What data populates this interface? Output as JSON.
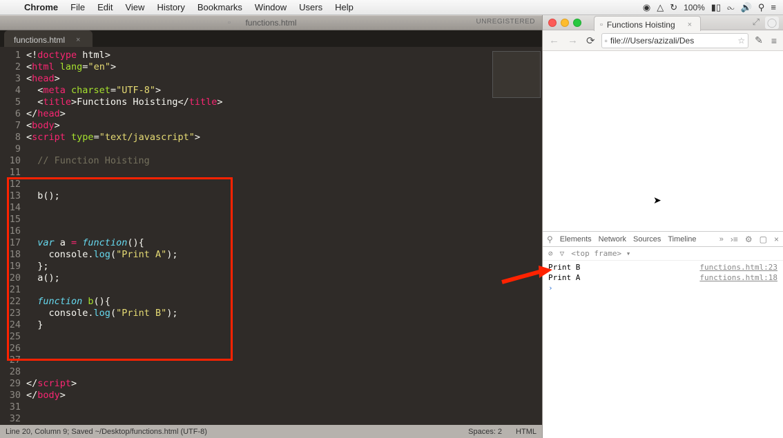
{
  "menubar": {
    "app": "Chrome",
    "items": [
      "File",
      "Edit",
      "View",
      "History",
      "Bookmarks",
      "Window",
      "Users",
      "Help"
    ],
    "battery": "100%"
  },
  "editor": {
    "title": "functions.html",
    "unregistered": "UNREGISTERED",
    "tab": "functions.html",
    "status_left": "Line 20, Column 9; Saved ~/Desktop/functions.html (UTF-8)",
    "status_spaces": "Spaces: 2",
    "status_lang": "HTML",
    "lines": [
      "1",
      "2",
      "3",
      "4",
      "5",
      "6",
      "7",
      "8",
      "9",
      "10",
      "11",
      "12",
      "13",
      "14",
      "15",
      "16",
      "17",
      "18",
      "19",
      "20",
      "21",
      "22",
      "23",
      "24",
      "25",
      "26",
      "27",
      "28",
      "29",
      "30",
      "31",
      "32"
    ]
  },
  "code": {
    "l1a": "<!",
    "l1b": "doctype",
    "l1c": " html",
    "l1d": ">",
    "l2a": "<",
    "l2b": "html",
    "l2c": " lang",
    "l2d": "=",
    "l2e": "\"en\"",
    "l2f": ">",
    "l3a": "<",
    "l3b": "head",
    "l3c": ">",
    "l4a": "  <",
    "l4b": "meta",
    "l4c": " charset",
    "l4d": "=",
    "l4e": "\"UTF-8\"",
    "l4f": ">",
    "l5a": "  <",
    "l5b": "title",
    "l5c": ">Functions Hoisting</",
    "l5d": "title",
    "l5e": ">",
    "l6a": "</",
    "l6b": "head",
    "l6c": ">",
    "l7a": "<",
    "l7b": "body",
    "l7c": ">",
    "l8a": "<",
    "l8b": "script",
    "l8c": " type",
    "l8d": "=",
    "l8e": "\"text/javascript\"",
    "l8f": ">",
    "l10": "  // Function Hoisting",
    "l13": "  b();",
    "l17a": "  var",
    "l17b": " a ",
    "l17c": "=",
    "l17d": " function",
    "l17e": "(){",
    "l18a": "    console.",
    "l18b": "log",
    "l18c": "(",
    "l18d": "\"Print A\"",
    "l18e": ");",
    "l19": "  };",
    "l20": "  a();",
    "l22a": "  function",
    "l22b": " b",
    "l22c": "(){",
    "l23a": "    console.",
    "l23b": "log",
    "l23c": "(",
    "l23d": "\"Print B\"",
    "l23e": ");",
    "l24": "  }",
    "l31a": "</",
    "l31b": "script",
    "l31c": ">",
    "l32a": "</",
    "l32b": "body",
    "l32c": ">"
  },
  "chrome": {
    "tab_title": "Functions Hoisting",
    "url": "file:///Users/azizali/Des"
  },
  "devtools": {
    "tabs": [
      "Elements",
      "Network",
      "Sources",
      "Timeline"
    ],
    "more": "»",
    "frame": "<top frame> ▾",
    "console": [
      {
        "msg": "Print B",
        "src": "functions.html:23"
      },
      {
        "msg": "Print A",
        "src": "functions.html:18"
      }
    ]
  }
}
